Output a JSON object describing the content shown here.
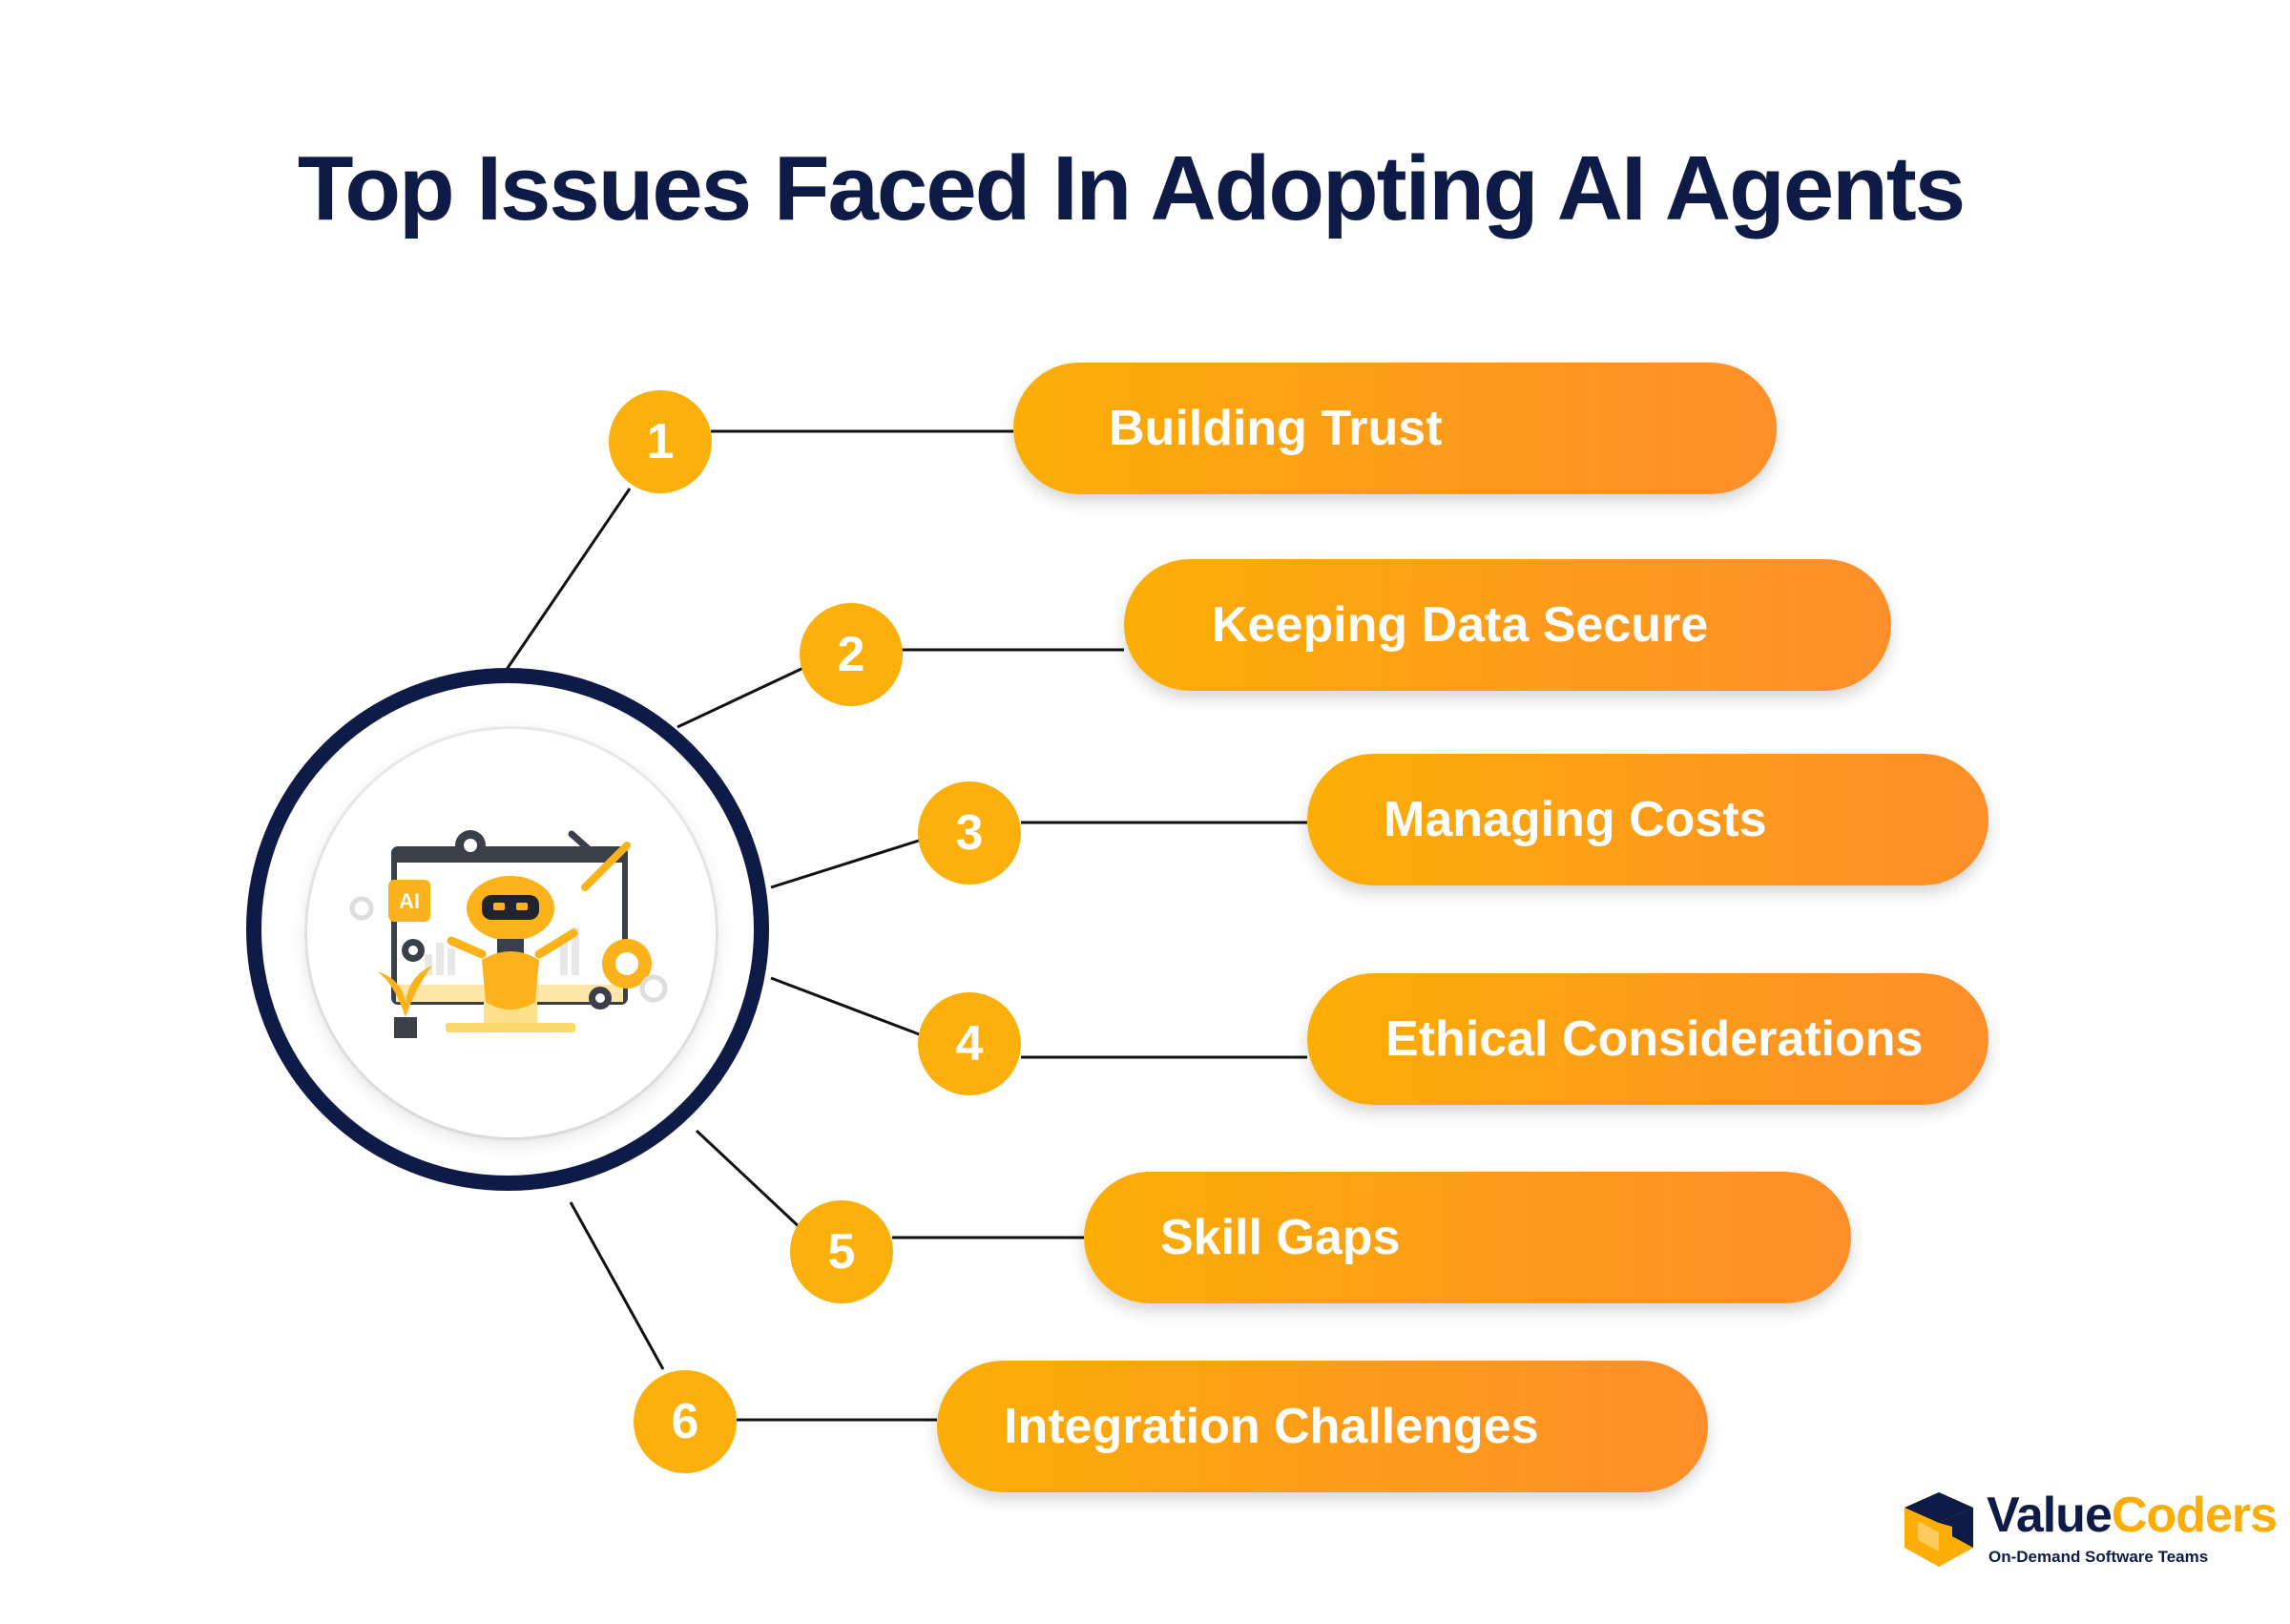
{
  "title": "Top Issues Faced In Adopting AI Agents",
  "hub": {
    "icon": "ai-robot-illustration-icon",
    "chip_label": "AI"
  },
  "items": [
    {
      "number": "1",
      "label": "Building Trust"
    },
    {
      "number": "2",
      "label": "Keeping Data Secure"
    },
    {
      "number": "3",
      "label": "Managing Costs"
    },
    {
      "number": "4",
      "label": "Ethical Considerations"
    },
    {
      "number": "5",
      "label": "Skill Gaps"
    },
    {
      "number": "6",
      "label": "Integration Challenges"
    }
  ],
  "brand": {
    "name_part1": "Value",
    "name_part2": "Coders",
    "tagline": "On-Demand Software Teams"
  },
  "colors": {
    "navy": "#0f1b47",
    "accent": "#fbb00c",
    "pill_gradient_end": "#fe8f2a"
  }
}
